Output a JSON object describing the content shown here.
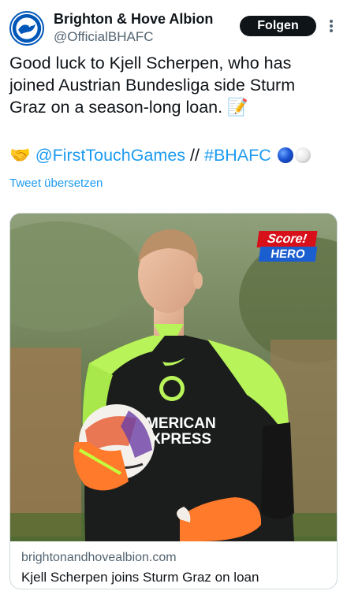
{
  "account": {
    "name": "Brighton & Hove Albion",
    "handle": "@OfficialBHAFC",
    "follow_label": "Folgen",
    "avatar_icon": "brighton-crest-icon"
  },
  "tweet": {
    "text": "Good luck to Kjell Scherpen, who has joined Austrian Bundesliga side Sturm Graz on a season-long loan.",
    "text_emoji": "📝",
    "mention": "@FirstTouchGames",
    "separator": "//",
    "hashtag": "#BHAFC",
    "translate_label": "Tweet übersetzen"
  },
  "card": {
    "domain": "brightonandhovealbion.com",
    "title": "Kjell Scherpen joins Sturm Graz on loan",
    "image": {
      "badge_top": "Score!",
      "badge_bottom": "HERO",
      "shirt_sponsor_line1": "MERICAN",
      "shirt_sponsor_line2": "XPRESS"
    }
  },
  "colors": {
    "link": "#1d9bf0",
    "text": "#0f1419",
    "secondary": "#536471",
    "follow_bg": "#0f1419"
  }
}
